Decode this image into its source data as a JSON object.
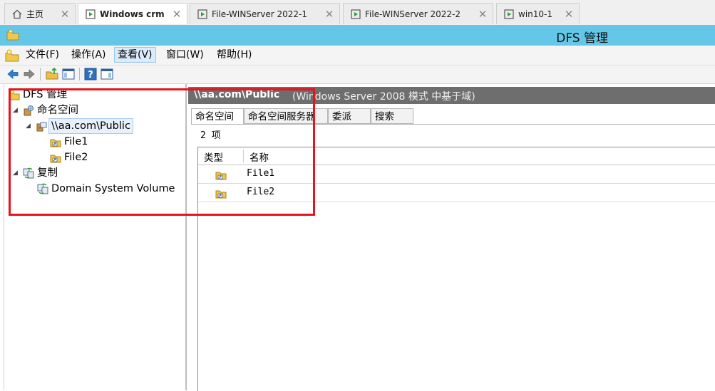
{
  "host_tabs": [
    {
      "label": "主页",
      "icon": "home-icon",
      "active": false
    },
    {
      "label": "Windows crm",
      "icon": "vm-icon",
      "active": true
    },
    {
      "label": "File-WINServer 2022-1",
      "icon": "vm-icon",
      "active": false
    },
    {
      "label": "File-WINServer 2022-2",
      "icon": "vm-icon",
      "active": false
    },
    {
      "label": "win10-1",
      "icon": "vm-icon",
      "active": false
    }
  ],
  "window": {
    "title": "DFS 管理"
  },
  "menu": {
    "items": [
      "文件(F)",
      "操作(A)",
      "查看(V)",
      "窗口(W)",
      "帮助(H)"
    ],
    "active_item": "查看(V)"
  },
  "toolbar": {
    "buttons": [
      "back-arrow-icon",
      "forward-arrow-icon",
      "up-folder-icon",
      "show-hide-tree-icon",
      "help-icon",
      "show-action-pane-icon"
    ]
  },
  "tree": {
    "root": "DFS 管理",
    "namespaces": "命名空间",
    "namespace_root": "\\\\aa.com\\Public",
    "folders": [
      "File1",
      "File2"
    ],
    "replication": "复制",
    "replication_group": "Domain System Volume"
  },
  "banner": {
    "path": "\\\\aa.com\\Public",
    "description": "(Windows Server 2008 模式 中基于域)"
  },
  "detail_tabs": [
    "命名空间",
    "命名空间服务器",
    "委派",
    "搜索"
  ],
  "item_count": "2 项",
  "list": {
    "columns": [
      "类型",
      "名称"
    ],
    "rows": [
      {
        "name": "File1"
      },
      {
        "name": "File2"
      }
    ]
  },
  "colors": {
    "title_bar": "#64c7e8",
    "banner": "#6e6e6e",
    "highlight": "#e8141c"
  }
}
